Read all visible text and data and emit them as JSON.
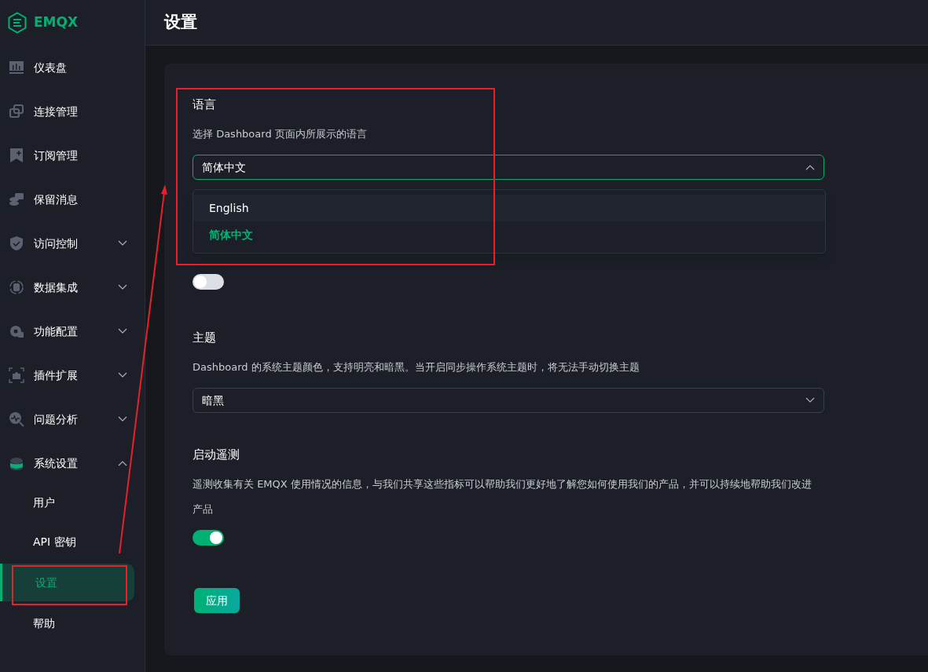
{
  "logo": {
    "text": "EMQX"
  },
  "sidebar": {
    "items": [
      {
        "label": "仪表盘"
      },
      {
        "label": "连接管理"
      },
      {
        "label": "订阅管理"
      },
      {
        "label": "保留消息"
      },
      {
        "label": "访问控制",
        "expanded": false
      },
      {
        "label": "数据集成",
        "expanded": false
      },
      {
        "label": "功能配置",
        "expanded": false
      },
      {
        "label": "插件扩展",
        "expanded": false
      },
      {
        "label": "问题分析",
        "expanded": false
      },
      {
        "label": "系统设置",
        "expanded": true,
        "children": [
          {
            "label": "用户",
            "selected": false
          },
          {
            "label": "API 密钥",
            "selected": false
          },
          {
            "label": "设置",
            "selected": true
          },
          {
            "label": "帮助",
            "selected": false
          }
        ]
      }
    ]
  },
  "header": {
    "title": "设置"
  },
  "sections": [
    {
      "kind": "select",
      "title": "语言",
      "description": "选择 Dashboard 页面内所展示的语言",
      "value": "简体中文",
      "open": true,
      "options": [
        {
          "label": "English",
          "hovered": true,
          "selected": false
        },
        {
          "label": "简体中文",
          "hovered": false,
          "selected": true
        }
      ]
    },
    {
      "kind": "toggle",
      "on": false
    },
    {
      "kind": "select",
      "title": "主题",
      "description": "Dashboard 的系统主题颜色，支持明亮和暗黑。当开启同步操作系统主题时，将无法手动切换主题",
      "value": "暗黑",
      "open": false
    },
    {
      "kind": "toggle",
      "title": "启动遥测",
      "description": "遥测收集有关 EMQX 使用情况的信息，与我们共享这些指标可以帮助我们更好地了解您如何使用我们的产品，并可以持续地帮助我们改进产品",
      "on": true
    }
  ],
  "apply_button": {
    "label": "应用"
  }
}
